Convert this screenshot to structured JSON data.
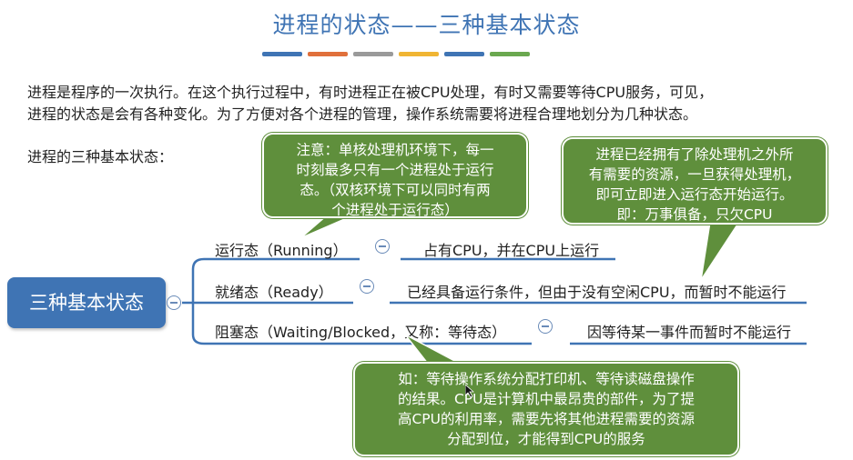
{
  "title": "进程的状态——三种基本状态",
  "title_bar_colors": [
    "#3f74b4",
    "#e0703b",
    "#9a9a9a",
    "#f0b533",
    "#3f74b4",
    "#6aa84f"
  ],
  "intro_line1": "进程是程序的一次执行。在这个执行过程中，有时进程正在被CPU处理，有时又需要等待CPU服务，可见，",
  "intro_line2": "进程的状态是会有各种变化。为了方便对各个进程的管理，操作系统需要将进程合理地划分为几种状态。",
  "subheading": "进程的三种基本状态：",
  "mindmap": {
    "root": "三种基本状态",
    "branches": [
      {
        "label": "运行态（Running）",
        "desc": "占有CPU，并在CPU上运行"
      },
      {
        "label": "就绪态（Ready）",
        "desc": "已经具备运行条件，但由于没有空闲CPU，而暂时不能运行"
      },
      {
        "label": "阻塞态（Waiting/Blocked，又称：等待态）",
        "desc": "因等待某一事件而暂时不能运行"
      }
    ]
  },
  "notes": {
    "running": {
      "line1": "注意：单核处理机环境下，每一",
      "line2": "时刻最多只有一个进程处于运行",
      "line3": "态。（双核环境下可以同时有两",
      "line4": "个进程处于运行态）"
    },
    "ready": {
      "line1": "进程已经拥有了除处理机之外所",
      "line2": "有需要的资源，一旦获得处理机，",
      "line3": "即可立即进入运行态开始运行。",
      "line4": "即：万事俱备，只欠CPU"
    },
    "blocked": {
      "line1": "如：等待操作系统分配打印机、等待读磁盘操作",
      "line2": "的结果。CPU是计算机中最昂贵的部件，为了提",
      "line3": "高CPU的利用率，需要先将其他进程需要的资源",
      "line4": "分配到位，才能得到CPU的服务"
    }
  },
  "colors": {
    "title": "#3f74b4",
    "root_bg": "#3f74b4",
    "note_bg": "#5f8f3c",
    "connector": "#3f74b4"
  }
}
